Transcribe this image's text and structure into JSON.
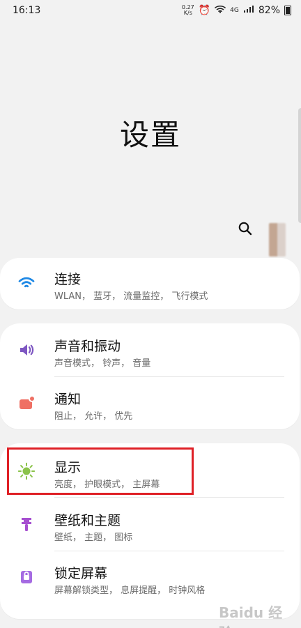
{
  "status_bar": {
    "time": "16:13",
    "net_speed_value": "0.27",
    "net_speed_unit": "K/s",
    "network_label": "4G",
    "battery": "82%"
  },
  "page": {
    "title": "设置"
  },
  "groups": [
    {
      "items": [
        {
          "label": "连接",
          "subtitle": "WLAN， 蓝牙， 流量监控， 飞行模式",
          "icon": "wifi-icon",
          "color": "#1e88e5"
        }
      ]
    },
    {
      "items": [
        {
          "label": "声音和振动",
          "subtitle": "声音模式， 铃声， 音量",
          "icon": "speaker-icon",
          "color": "#7e57c2"
        },
        {
          "label": "通知",
          "subtitle": "阻止， 允许， 优先",
          "icon": "notification-icon",
          "color": "#ef7064"
        }
      ]
    },
    {
      "items": [
        {
          "label": "显示",
          "subtitle": "亮度， 护眼模式， 主屏幕",
          "icon": "brightness-icon",
          "color": "#8bc34a"
        },
        {
          "label": "壁纸和主题",
          "subtitle": "壁纸， 主题， 图标",
          "icon": "brush-icon",
          "color": "#a64fd0"
        },
        {
          "label": "锁定屏幕",
          "subtitle": "屏幕解锁类型， 息屏提醒， 时钟风格",
          "icon": "lock-icon",
          "color": "#a56be2"
        }
      ]
    }
  ],
  "watermark": {
    "text": "Baidu 经验"
  }
}
